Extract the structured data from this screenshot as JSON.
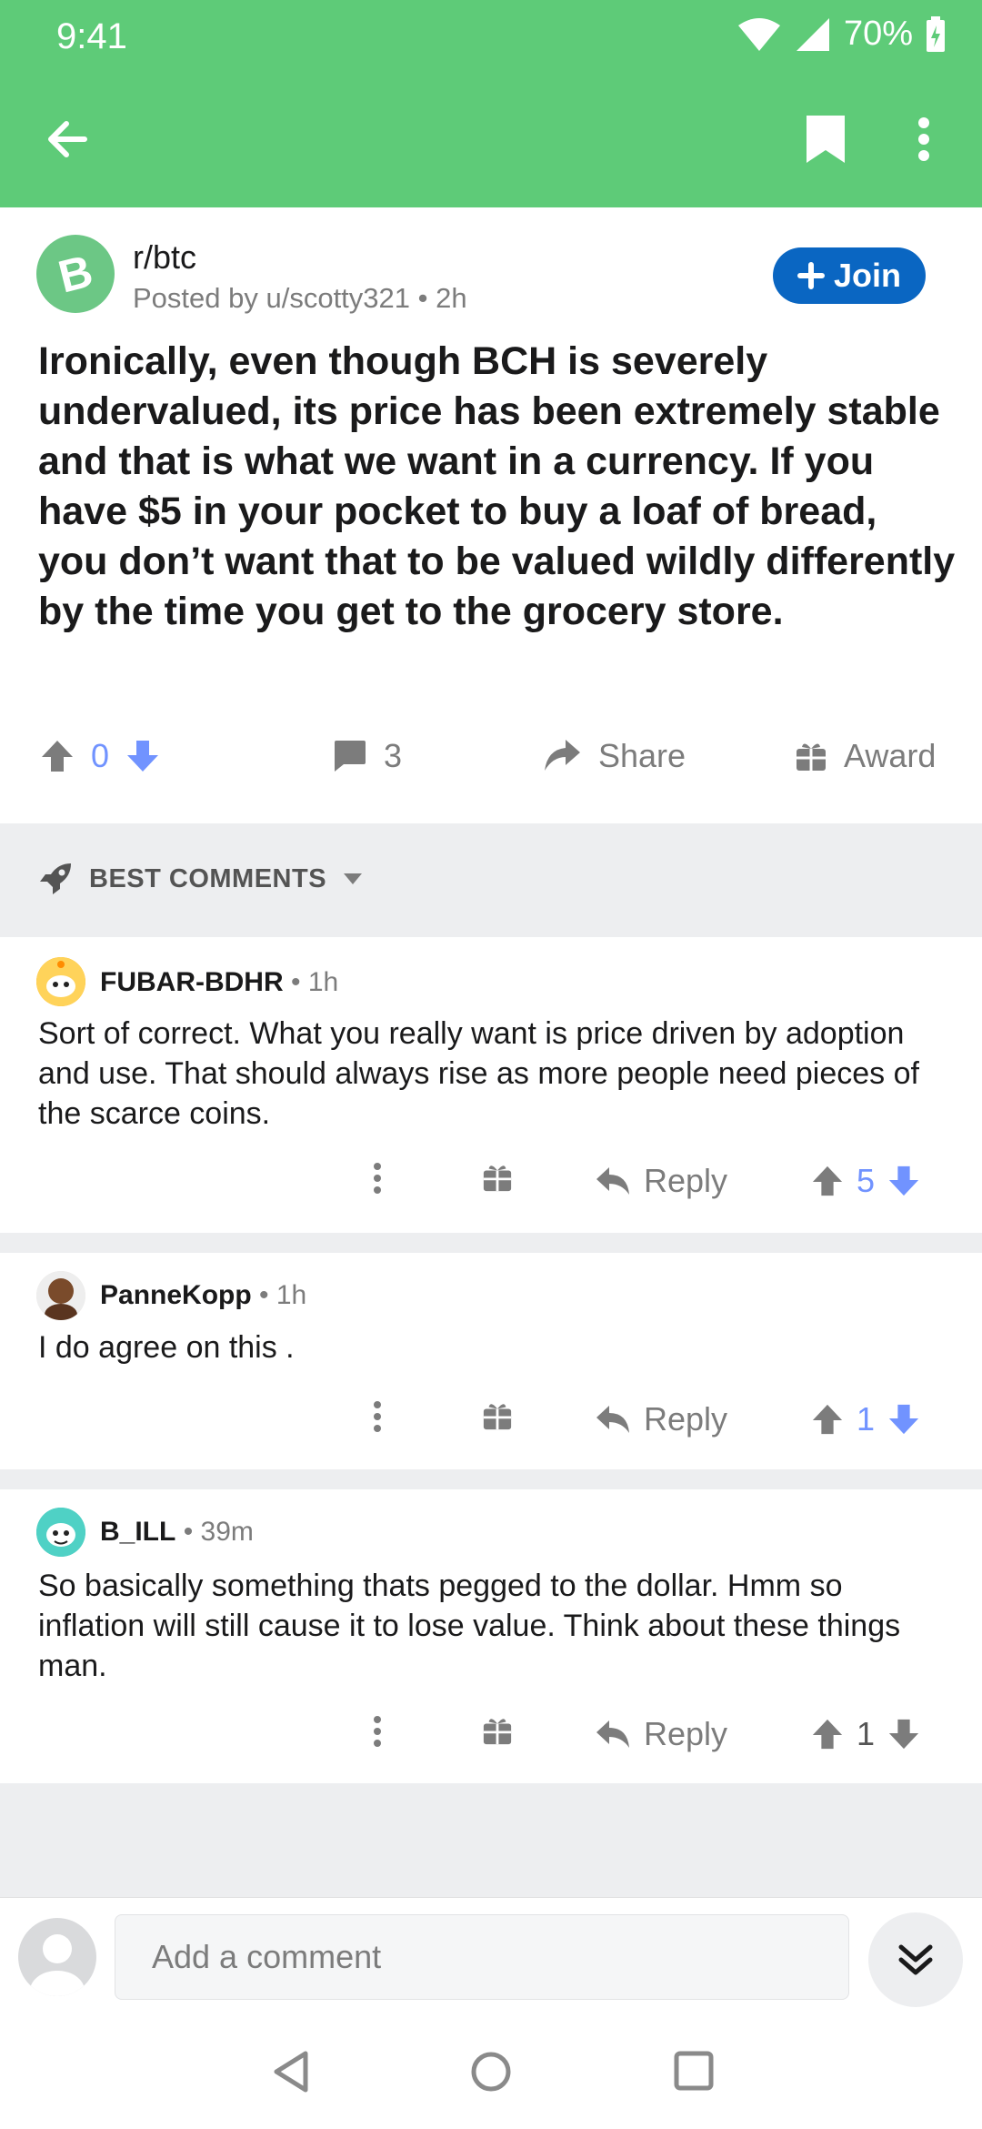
{
  "status_bar": {
    "time": "9:41",
    "battery": "70%"
  },
  "post": {
    "subreddit": "r/btc",
    "subreddit_icon_letter": "B",
    "posted_by": "Posted by u/scotty321",
    "age": "2h",
    "join_label": "Join",
    "title": "Ironically, even though BCH is severely undervalued, its price has been extremely stable and that is what we want in a currency. If you have $5 in your pocket to buy a loaf of bread, you don’t want that to be valued wildly differently by the time you get to the grocery store.",
    "votes": "0",
    "comments": "3",
    "share_label": "Share",
    "award_label": "Award"
  },
  "sort": {
    "label": "BEST COMMENTS"
  },
  "comments": [
    {
      "author": "FUBAR-BDHR",
      "age": "1h",
      "body": "Sort of correct. What you really want is price driven by adoption and use.  That should always rise as more people need pieces of the scarce coins.",
      "reply_label": "Reply",
      "votes": "5"
    },
    {
      "author": "PanneKopp",
      "age": "1h",
      "body": "I do agree on this .",
      "reply_label": "Reply",
      "votes": "1"
    },
    {
      "author": "B_ILL",
      "age": "39m",
      "body": "So basically something thats pegged to the dollar. Hmm so inflation will still cause it to lose value. Think about these things man.",
      "reply_label": "Reply",
      "votes": "1"
    }
  ],
  "composer": {
    "placeholder": "Add a comment"
  },
  "colors": {
    "app_bar": "#5ecb78",
    "join": "#0a66c2",
    "vote_blue": "#7193ff",
    "meta_gray": "#7c7c7c"
  }
}
